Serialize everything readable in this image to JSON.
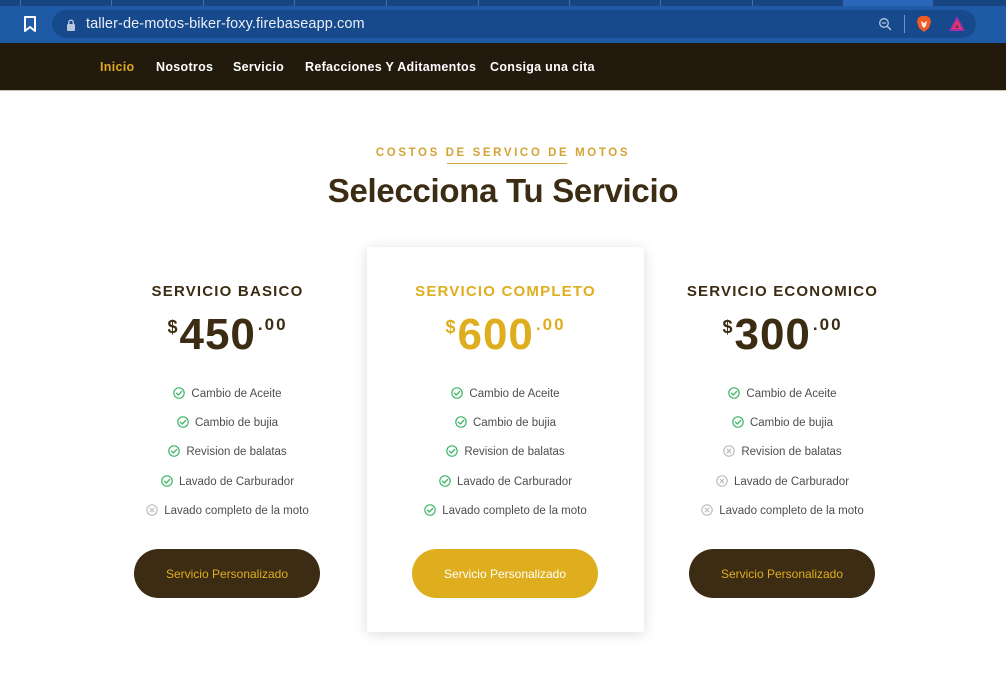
{
  "browser": {
    "url": "taller-de-motos-biker-foxy.firebaseapp.com"
  },
  "nav": {
    "items": [
      {
        "label": "Inicio",
        "active": true
      },
      {
        "label": "Nosotros",
        "active": false
      },
      {
        "label": "Servicio",
        "active": false
      },
      {
        "label": "Refacciones Y Aditamentos",
        "active": false
      },
      {
        "label": "Consiga una cita",
        "active": false
      }
    ]
  },
  "section": {
    "eyebrow": "COSTOS DE SERVICO DE MOTOS",
    "title": "Selecciona Tu Servicio"
  },
  "plans": [
    {
      "name": "SERVICIO BASICO",
      "currency": "$",
      "amount": "450",
      "cents": ".00",
      "featured": false,
      "features": [
        {
          "label": "Cambio de Aceite",
          "included": true
        },
        {
          "label": "Cambio de bujia",
          "included": true
        },
        {
          "label": "Revision de balatas",
          "included": true
        },
        {
          "label": "Lavado de Carburador",
          "included": true
        },
        {
          "label": "Lavado completo de la moto",
          "included": false
        }
      ],
      "button": "Servicio Personalizado"
    },
    {
      "name": "SERVICIO COMPLETO",
      "currency": "$",
      "amount": "600",
      "cents": ".00",
      "featured": true,
      "features": [
        {
          "label": "Cambio de Aceite",
          "included": true
        },
        {
          "label": "Cambio de bujia",
          "included": true
        },
        {
          "label": "Revision de balatas",
          "included": true
        },
        {
          "label": "Lavado de Carburador",
          "included": true
        },
        {
          "label": "Lavado completo de la moto",
          "included": true
        }
      ],
      "button": "Servicio Personalizado"
    },
    {
      "name": "SERVICIO ECONOMICO",
      "currency": "$",
      "amount": "300",
      "cents": ".00",
      "featured": false,
      "features": [
        {
          "label": "Cambio de Aceite",
          "included": true
        },
        {
          "label": "Cambio de bujia",
          "included": true
        },
        {
          "label": "Revision de balatas",
          "included": false
        },
        {
          "label": "Lavado de Carburador",
          "included": false
        },
        {
          "label": "Lavado completo de la moto",
          "included": false
        }
      ],
      "button": "Servicio Personalizado"
    }
  ],
  "colors": {
    "accent": "#dfae1e",
    "brown": "#3b2c13",
    "nav_bg": "#231a0e",
    "check": "#3fb56a",
    "cross": "#bdbdbd"
  },
  "icons": {
    "included": "check-circle-icon",
    "excluded": "x-circle-icon"
  }
}
